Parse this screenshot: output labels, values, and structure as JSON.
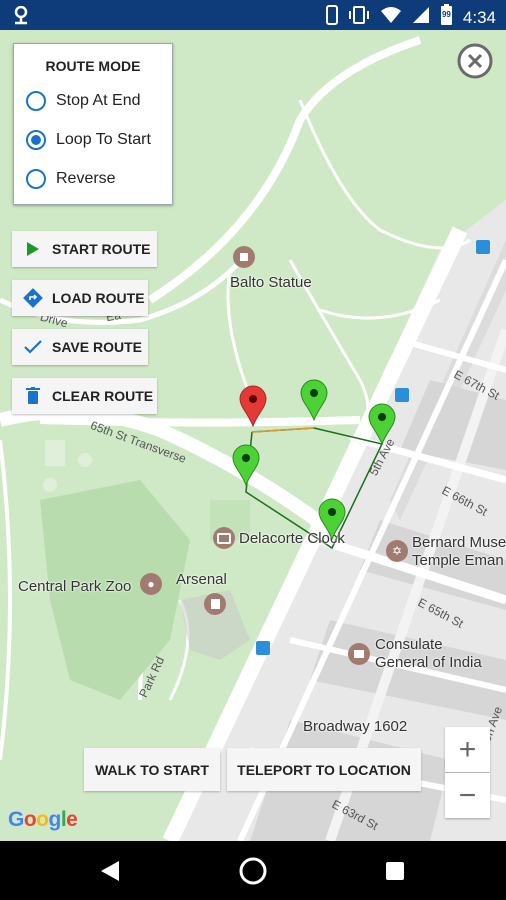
{
  "status_bar": {
    "time": "4:34",
    "battery": "99",
    "icons": [
      "location-pin-icon",
      "phone-icon",
      "vibrate-icon",
      "wifi-icon",
      "signal-icon",
      "battery-icon"
    ]
  },
  "route_mode": {
    "title": "ROUTE MODE",
    "options": [
      {
        "label": "Stop At End",
        "selected": false
      },
      {
        "label": "Loop To Start",
        "selected": true
      },
      {
        "label": "Reverse",
        "selected": false
      }
    ]
  },
  "actions": {
    "start_route": "START ROUTE",
    "load_route": "LOAD ROUTE",
    "save_route": "SAVE ROUTE",
    "clear_route": "CLEAR ROUTE"
  },
  "bottom": {
    "walk_to_start": "WALK TO START",
    "teleport": "TELEPORT TO LOCATION"
  },
  "zoom": {
    "in": "+",
    "out": "−"
  },
  "map_labels": {
    "balto": "Balto Statue",
    "delacorte": "Delacorte Clock",
    "zoo": "Central Park Zoo",
    "arsenal": "Arsenal",
    "bernard": "Bernard Muse",
    "temple": "Temple Eman",
    "consulate1": "Consulate",
    "consulate2": "General of India",
    "broadway": "Broadway 1602",
    "transverse": "65th St Transverse",
    "fifth_ave": "5th Ave",
    "e67": "E 67th St",
    "e66": "E 66th St",
    "e65": "E 65th St",
    "e63": "E 63rd St",
    "park_rd": "Park Rd",
    "drive": "Drive",
    "madison": "son Ave",
    "east": "Ea"
  },
  "attribution": "Google",
  "colors": {
    "status_bar": "#0e3b7a",
    "park": "#cfe9c6",
    "accent": "#1a73c8",
    "marker_start": "#e53935",
    "marker_waypoint": "#4cd137",
    "route_line": "#1b6e1b"
  }
}
